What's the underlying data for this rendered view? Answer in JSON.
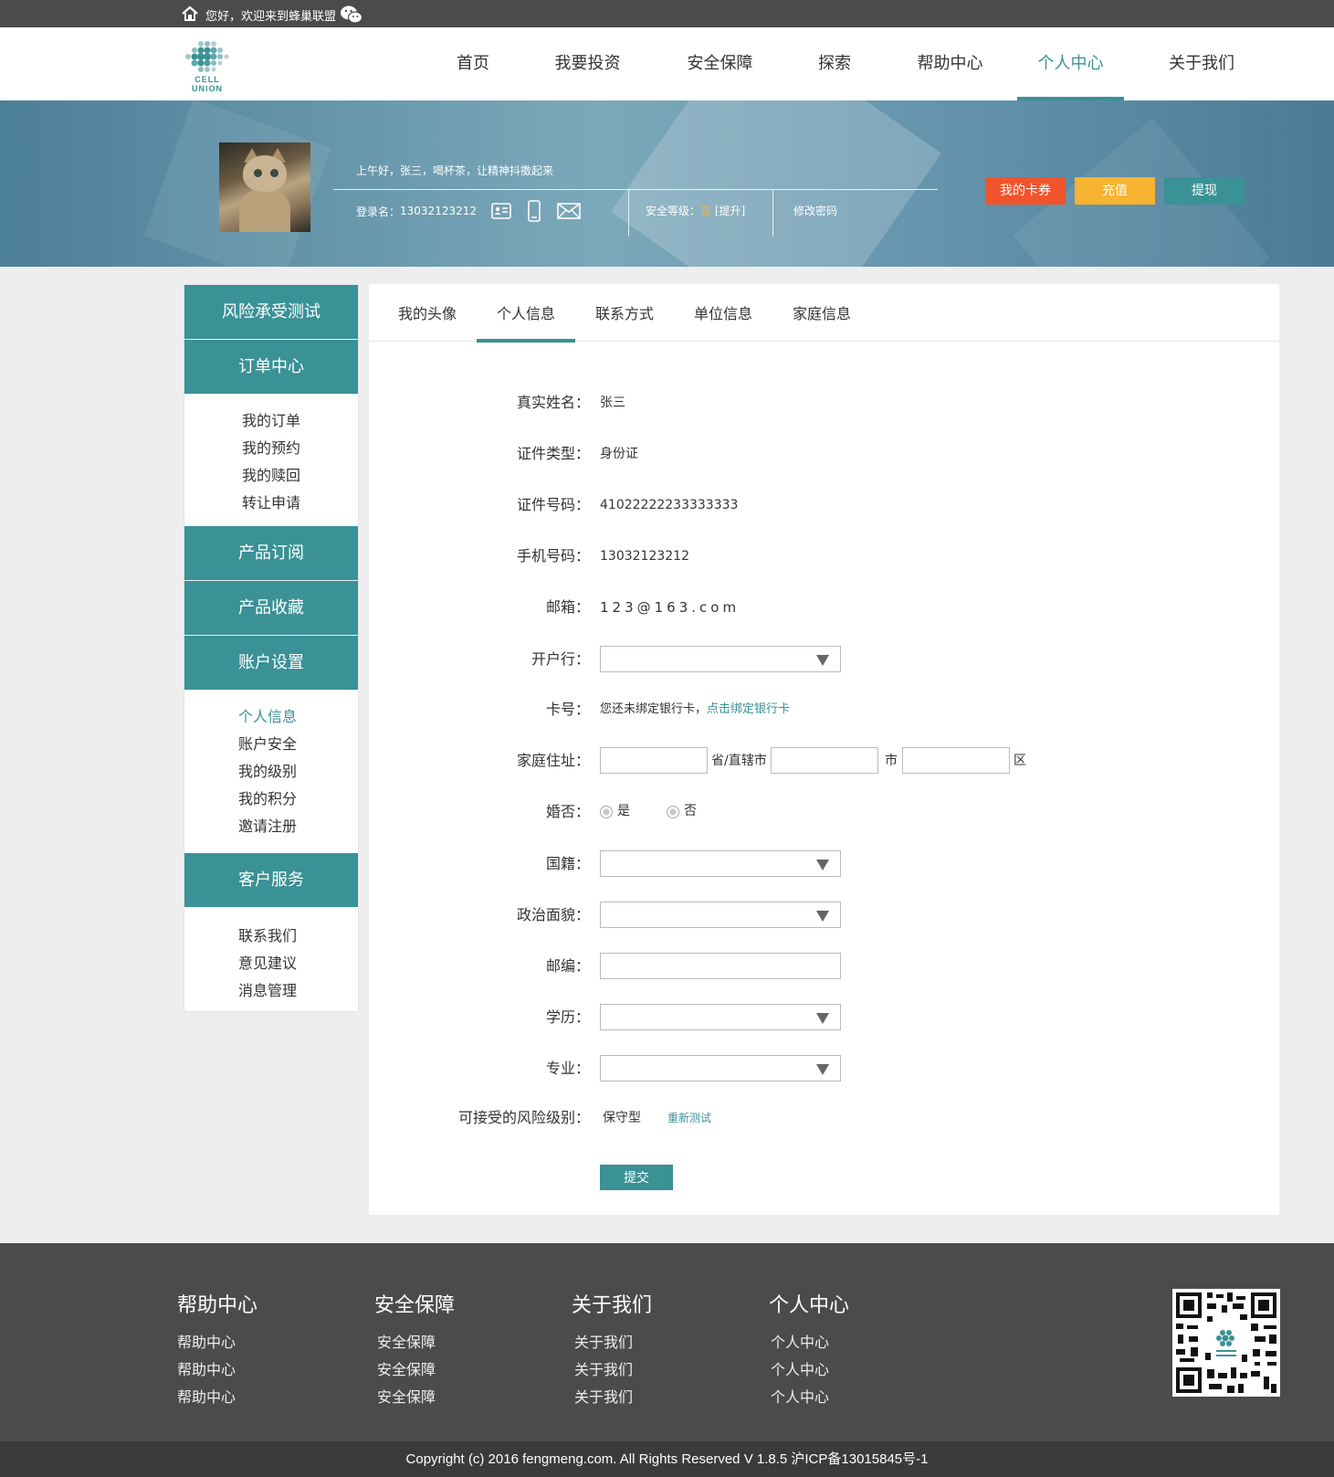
{
  "topbar": {
    "greeting": "您好，欢迎来到蜂巢联盟",
    "home_icon": "home-icon",
    "wechat_icon": "wechat-icon"
  },
  "brand": {
    "logo_line1": "CELL",
    "logo_line2": "UNION",
    "color": "#3a9196"
  },
  "nav": {
    "items": [
      {
        "label": "首页"
      },
      {
        "label": "我要投资"
      },
      {
        "label": "安全保障"
      },
      {
        "label": "探索"
      },
      {
        "label": "帮助中心"
      },
      {
        "label": "个人中心",
        "active": true
      },
      {
        "label": "关于我们"
      }
    ]
  },
  "banner": {
    "greeting": "上午好，张三，喝杯茶，让精神抖擞起来",
    "login_label": "登录名：",
    "login_name": "13032123212",
    "security_label": "安全等级：",
    "security_level": "高",
    "security_upgrade": "[提升]",
    "change_password": "修改密码",
    "buttons": {
      "coupons": "我的卡券",
      "recharge": "充值",
      "withdraw": "提现"
    },
    "colors": {
      "coupons": "#f0542c",
      "recharge": "#f8b330",
      "withdraw": "#3a9196"
    }
  },
  "sidebar": {
    "risk_test": "风险承受测试",
    "orders": {
      "title": "订单中心",
      "items": [
        "我的订单",
        "我的预约",
        "我的赎回",
        "转让申请"
      ]
    },
    "subscriptions": "产品订阅",
    "favorites": "产品收藏",
    "account": {
      "title": "账户设置",
      "items": [
        "个人信息",
        "账户安全",
        "我的级别",
        "我的积分",
        "邀请注册"
      ],
      "active": "个人信息"
    },
    "service": {
      "title": "客户服务",
      "items": [
        "联系我们",
        "意见建议",
        "消息管理"
      ]
    }
  },
  "tabs": {
    "items": [
      "我的头像",
      "个人信息",
      "联系方式",
      "单位信息",
      "家庭信息"
    ],
    "active": "个人信息"
  },
  "form": {
    "real_name": {
      "label": "真实姓名：",
      "value": "张三"
    },
    "id_type": {
      "label": "证件类型：",
      "value": "身份证"
    },
    "id_number": {
      "label": "证件号码：",
      "value": "41022222233333333"
    },
    "phone": {
      "label": "手机号码：",
      "value": "13032123212"
    },
    "email": {
      "label": "邮箱：",
      "value": "123@163.com"
    },
    "bank": {
      "label": "开户行：",
      "value": ""
    },
    "card": {
      "label": "卡号：",
      "value": "您还未绑定银行卡，",
      "link": "点击绑定银行卡"
    },
    "address": {
      "label": "家庭住址：",
      "province_suffix": "省/直辖市",
      "city_suffix": "市",
      "district_suffix": "区",
      "province": "",
      "city": "",
      "district": ""
    },
    "married": {
      "label": "婚否：",
      "yes": "是",
      "no": "否"
    },
    "nationality": {
      "label": "国籍：",
      "value": ""
    },
    "political": {
      "label": "政治面貌：",
      "value": ""
    },
    "postcode": {
      "label": "邮编：",
      "value": ""
    },
    "education": {
      "label": "学历：",
      "value": ""
    },
    "major": {
      "label": "专业：",
      "value": ""
    },
    "risk": {
      "label": "可接受的风险级别：",
      "value": "保守型",
      "retest": "重新测试"
    },
    "submit": "提交"
  },
  "footer": {
    "columns": [
      {
        "title": "帮助中心",
        "links": [
          "帮助中心",
          "帮助中心",
          "帮助中心"
        ]
      },
      {
        "title": "安全保障",
        "links": [
          "安全保障",
          "安全保障",
          "安全保障"
        ]
      },
      {
        "title": "关于我们",
        "links": [
          "关于我们",
          "关于我们",
          "关于我们"
        ]
      },
      {
        "title": "个人中心",
        "links": [
          "个人中心",
          "个人中心",
          "个人中心"
        ]
      }
    ],
    "qr_icon": "qr-code-icon",
    "copyright": "Copyright (c) 2016 fengmeng.com. All Rights Reserved V 1.8.5 沪ICP备13015845号-1"
  }
}
